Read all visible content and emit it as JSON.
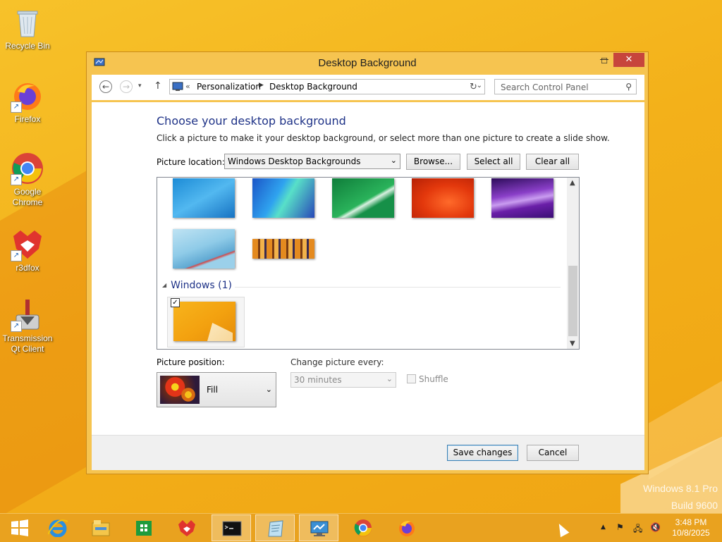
{
  "desktop": {
    "icons": [
      {
        "label": "Recycle Bin",
        "icon": "recycle-bin-icon"
      },
      {
        "label": "Firefox",
        "icon": "firefox-icon"
      },
      {
        "label": "Google Chrome",
        "icon": "chrome-icon"
      },
      {
        "label": "r3dfox",
        "icon": "r3dfox-icon"
      },
      {
        "label": "Transmission Qt Client",
        "icon": "transmission-icon"
      }
    ],
    "watermark_line1": "Windows 8.1 Pro",
    "watermark_line2": "Build 9600"
  },
  "window": {
    "title": "Desktop Background",
    "minimize": "—",
    "maximize": "☐",
    "close": "✕",
    "address": {
      "recent": "▾",
      "sep0": "«",
      "crumbs": [
        "Personalization",
        "Desktop Background"
      ],
      "sep": "▶"
    },
    "search_placeholder": "Search Control Panel"
  },
  "content": {
    "heading": "Choose your desktop background",
    "subtext": "Click a picture to make it your desktop background, or select more than one picture to create a slide show.",
    "picture_location_label": "Picture location:",
    "picture_location_value": "Windows Desktop Backgrounds",
    "browse": "Browse...",
    "select_all": "Select all",
    "clear_all": "Clear all",
    "group_label": "Windows (1)",
    "group_checked": "✓",
    "picture_position_label": "Picture position:",
    "picture_position_value": "Fill",
    "change_picture_label": "Change picture every:",
    "change_picture_value": "30 minutes",
    "shuffle_label": "Shuffle",
    "save": "Save changes",
    "cancel": "Cancel"
  },
  "taskbar": {
    "items": [
      "start-icon",
      "internet-explorer-icon",
      "file-explorer-icon",
      "store-icon",
      "r3dfox-icon",
      "command-prompt-icon",
      "notepad-icon",
      "control-panel-icon",
      "chrome-icon",
      "firefox-icon"
    ],
    "clock_time": "3:48 PM",
    "clock_date": "10/8/2025"
  },
  "colors": {
    "desktop": "#f3b51b",
    "window_frame": "#f6c450",
    "heading": "#1e3287",
    "close_button": "#c7453c"
  }
}
